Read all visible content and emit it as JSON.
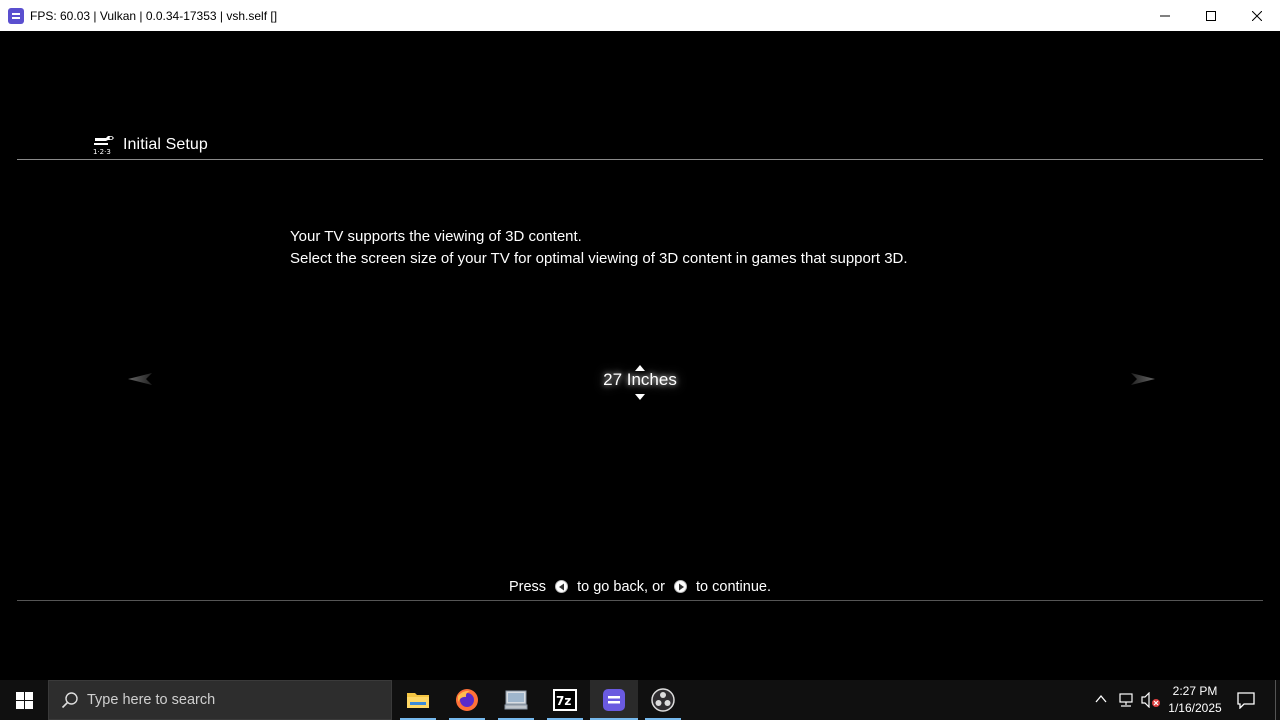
{
  "window": {
    "title": "FPS: 60.03 | Vulkan | 0.0.34-17353 | vsh.self []",
    "controls": [
      "minimize-icon",
      "maximize-icon",
      "close-icon"
    ]
  },
  "setup": {
    "header_title": "Initial Setup",
    "header_icon": "tools-123-icon",
    "message_line1": "Your TV supports the viewing of 3D content.",
    "message_line2": "Select the screen size of your TV for optimal viewing of 3D content in games that support 3D.",
    "selected_value": "27 Inches",
    "hint_press": "Press",
    "hint_back": "to go back, or",
    "hint_continue": "to continue."
  },
  "taskbar": {
    "search_placeholder": "Type here to search",
    "apps": [
      {
        "name": "File Explorer",
        "icon": "folder-icon"
      },
      {
        "name": "Firefox",
        "icon": "firefox-icon"
      },
      {
        "name": "Network Drive",
        "icon": "computer-icon"
      },
      {
        "name": "7-Zip",
        "icon": "7zip-icon",
        "label": "7z"
      },
      {
        "name": "RPCS3",
        "icon": "rpcs3-icon",
        "active": true
      },
      {
        "name": "OBS Studio",
        "icon": "obs-icon"
      }
    ],
    "clock_time": "2:27 PM",
    "clock_date": "1/16/2025"
  },
  "colors": {
    "accent_blue": "#76b9ed",
    "rpcs3_purple": "#5a4fcf",
    "background": "#000000"
  }
}
